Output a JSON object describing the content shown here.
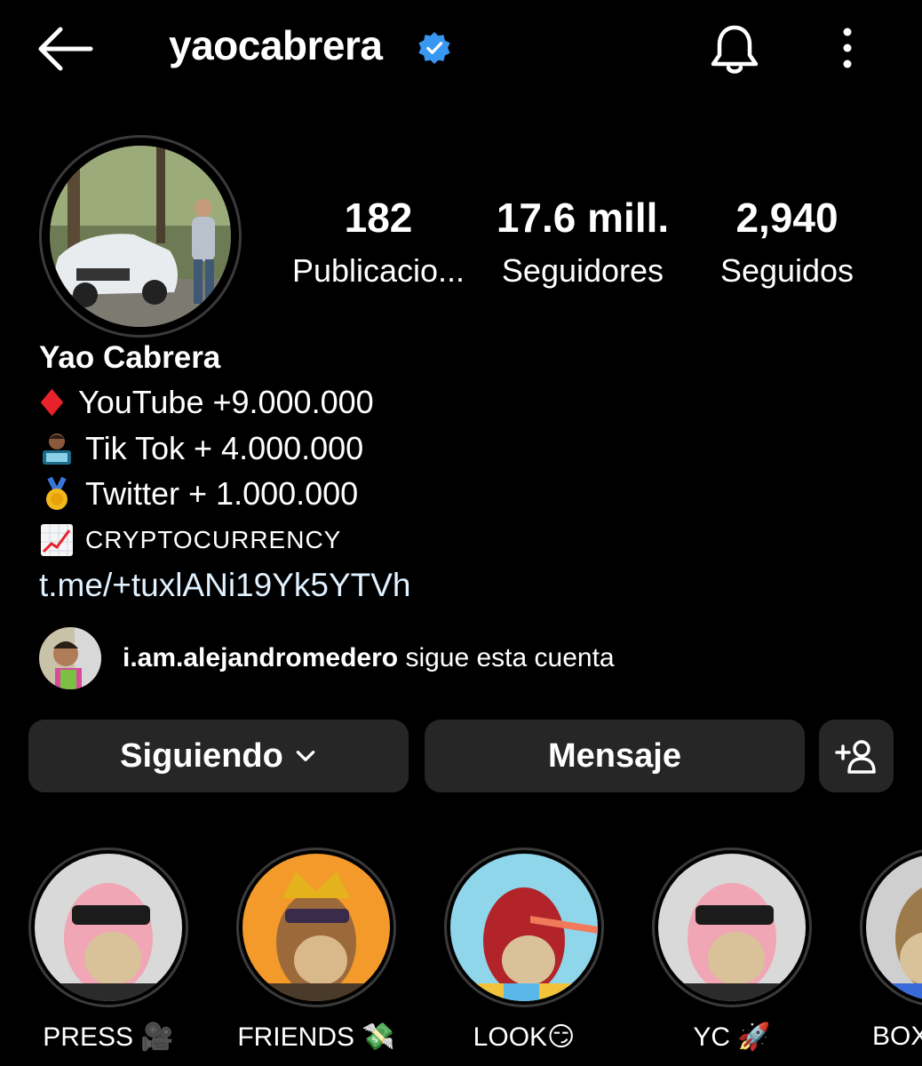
{
  "header": {
    "username": "yaocabrera"
  },
  "stats": [
    {
      "value": "182",
      "label": "Publicacio..."
    },
    {
      "value": "17.6 mill.",
      "label": "Seguidores"
    },
    {
      "value": "2,940",
      "label": "Seguidos"
    }
  ],
  "profile": {
    "name": "Yao Cabrera",
    "bio": [
      {
        "icon": "red-diamond-emoji",
        "text": "YouTube +9.000.000"
      },
      {
        "icon": "technologist-emoji",
        "text": "Tik Tok + 4.000.000"
      },
      {
        "icon": "gold-medal-emoji",
        "text": "Twitter + 1.000.000"
      },
      {
        "icon": "chart-increasing-emoji",
        "text": "CRYPTOCURRENCY"
      }
    ],
    "link": "t.me/+tuxlANi19Yk5YTVh"
  },
  "followed_by": {
    "username": "i.am.alejandromedero",
    "suffix": " sigue esta cuenta"
  },
  "buttons": {
    "following": "Siguiendo",
    "message": "Mensaje"
  },
  "highlights": [
    {
      "label": "PRESS 🎥",
      "bg": "#d9d9d9"
    },
    {
      "label": "FRIENDS 💸",
      "bg": "#f39a2a"
    },
    {
      "label": "LOOK😏",
      "bg": "#8fd6ea"
    },
    {
      "label": "YC 🚀",
      "bg": "#d9d9d9"
    },
    {
      "label": "BOX",
      "bg": "#cfcfcf"
    }
  ],
  "colors": {
    "background": "#000000",
    "button": "#262626",
    "verified": "#3897f0",
    "link": "#e0f1ff"
  }
}
